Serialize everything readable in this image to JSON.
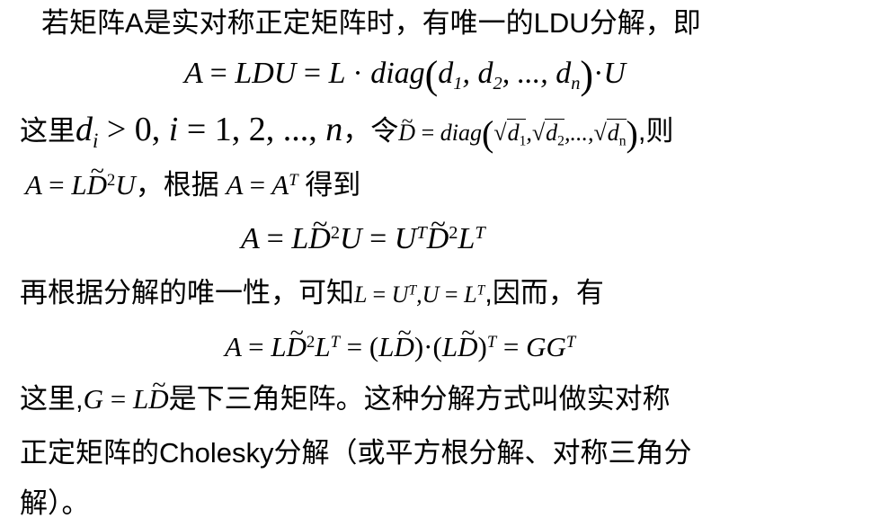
{
  "p1": {
    "text": "若矩阵A是实对称正定矩阵时，有唯一的LDU分解，即"
  },
  "eq1": {
    "text": "A = LDU = L · diag(d₁, d₂, ..., dₙ) · U"
  },
  "p2": {
    "prefix": "这里",
    "cond": "dᵢ > 0, i = 1, 2, ..., n",
    "mid": "，令",
    "def": "D̃ = diag(√d₁, √d₂, ..., √dₙ)",
    "suffix": ",则"
  },
  "p3": {
    "eq": "A = LD̃²U",
    "mid": "，根据",
    "eq2": "A = Aᵀ",
    "suffix": "得到"
  },
  "eq2": {
    "text": "A = LD̃²U = UᵀD̃²Lᵀ"
  },
  "p4": {
    "prefix": "再根据分解的唯一性，可知",
    "eq": "L = Uᵀ, U = Lᵀ",
    "suffix": ",因而，有"
  },
  "eq3": {
    "text": "A = LD̃²Lᵀ = (LD̃)·(LD̃)ᵀ = GGᵀ"
  },
  "p5": {
    "prefix": "这里,",
    "eq": "G = LD̃",
    "suffix": "是下三角矩阵。这种分解方式叫做实对称"
  },
  "p6": {
    "text": "正定矩阵的Cholesky分解（或平方根分解、对称三角分"
  },
  "p7": {
    "text": "解）。"
  }
}
